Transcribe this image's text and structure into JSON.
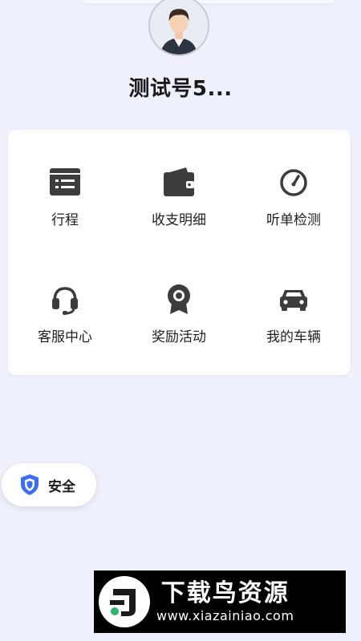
{
  "profile": {
    "name": "测试号5..."
  },
  "menu": [
    {
      "label": "行程",
      "icon": "itinerary-icon"
    },
    {
      "label": "收支明细",
      "icon": "wallet-icon"
    },
    {
      "label": "听单检测",
      "icon": "gauge-icon"
    },
    {
      "label": "客服中心",
      "icon": "headset-icon"
    },
    {
      "label": "奖励活动",
      "icon": "award-icon"
    },
    {
      "label": "我的车辆",
      "icon": "car-icon"
    }
  ],
  "safety": {
    "label": "安全",
    "icon": "shield-icon",
    "color": "#3d6df2"
  },
  "watermark": {
    "title": "下载鸟资源",
    "url": "www.xiazainiao.com"
  },
  "colors": {
    "background": "#eef0fb",
    "icon": "#3c3c3c",
    "card": "#ffffff"
  }
}
